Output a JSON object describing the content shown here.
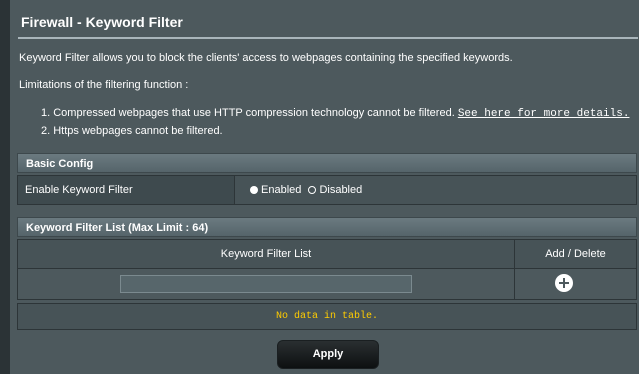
{
  "header": {
    "title": "Firewall - Keyword Filter"
  },
  "description": {
    "intro": "Keyword Filter allows you to block the clients' access to webpages containing the specified keywords.",
    "limitations_title": "Limitations of the filtering function :",
    "item1": "1. Compressed webpages that use HTTP compression technology cannot be filtered.",
    "item1_link": "See here for more details.",
    "item2": "2. Https webpages cannot be filtered."
  },
  "basic_config": {
    "title": "Basic Config",
    "enable_label": "Enable Keyword Filter",
    "options": [
      "Enabled",
      "Disabled"
    ],
    "selected": "Enabled"
  },
  "keyword_list": {
    "title": "Keyword Filter List (Max Limit : 64)",
    "col_list": "Keyword Filter List",
    "col_action": "Add / Delete",
    "input_value": "",
    "empty_text": "No data in table."
  },
  "actions": {
    "apply_label": "Apply"
  }
}
